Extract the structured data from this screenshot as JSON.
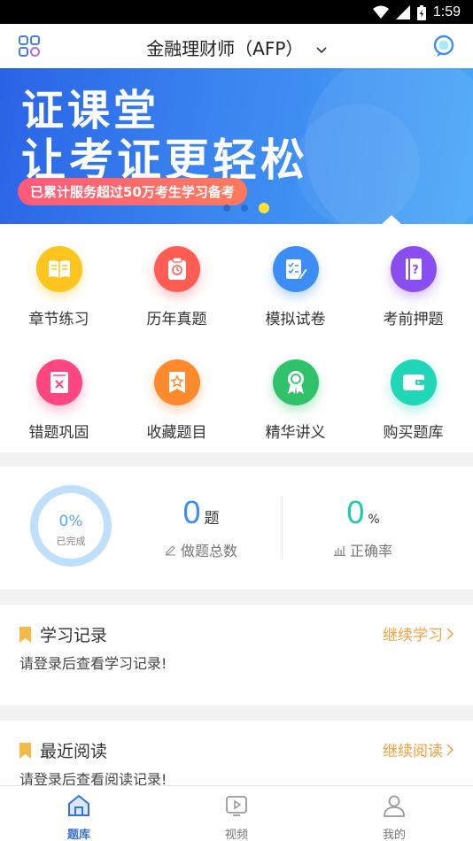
{
  "status_bar": {
    "time": "1:59"
  },
  "header": {
    "title": "金融理财师（AFP）"
  },
  "banner": {
    "line1": "证课堂",
    "line2": "让考证更轻松",
    "pill": "已累计服务超过50万考生学习备考"
  },
  "menu": {
    "items": [
      {
        "label": "章节练习",
        "icon": "book-icon",
        "color": "#ffc51f"
      },
      {
        "label": "历年真题",
        "icon": "clipboard-clock-icon",
        "color": "#ff5d53"
      },
      {
        "label": "模拟试卷",
        "icon": "checklist-pen-icon",
        "color": "#3c8df5"
      },
      {
        "label": "考前押题",
        "icon": "question-notebook-icon",
        "color": "#8a4df0"
      },
      {
        "label": "错题巩固",
        "icon": "wrong-book-icon",
        "color": "#ff4680"
      },
      {
        "label": "收藏题目",
        "icon": "star-bookmark-icon",
        "color": "#ff8a2e"
      },
      {
        "label": "精华讲义",
        "icon": "award-icon",
        "color": "#2fc26a"
      },
      {
        "label": "购买题库",
        "icon": "wallet-icon",
        "color": "#1fd6b6"
      }
    ]
  },
  "stats": {
    "ring_percent": "0%",
    "ring_label": "已完成",
    "completion_fraction": 0,
    "total_count": "0",
    "total_unit": "题",
    "total_label": "做题总数",
    "accuracy": "0",
    "accuracy_unit": "%",
    "accuracy_label": "正确率",
    "colors": {
      "total": "#3c8df5",
      "accuracy": "#1fcba8",
      "ring": "#bfe0fb"
    }
  },
  "study_record": {
    "title": "学习记录",
    "link": "继续学习",
    "message": "请登录后查看学习记录!"
  },
  "recent_reading": {
    "title": "最近阅读",
    "link": "继续阅读",
    "message": "请登录后查看阅读记录!"
  },
  "bottom_nav": {
    "items": [
      {
        "label": "题库",
        "icon": "home-icon",
        "active": true
      },
      {
        "label": "视频",
        "icon": "video-icon",
        "active": false
      },
      {
        "label": "我的",
        "icon": "user-icon",
        "active": false
      }
    ]
  },
  "colors": {
    "accent": "#3a6fd8",
    "link": "#f5a03c",
    "bookmark": "#f5b94a"
  }
}
